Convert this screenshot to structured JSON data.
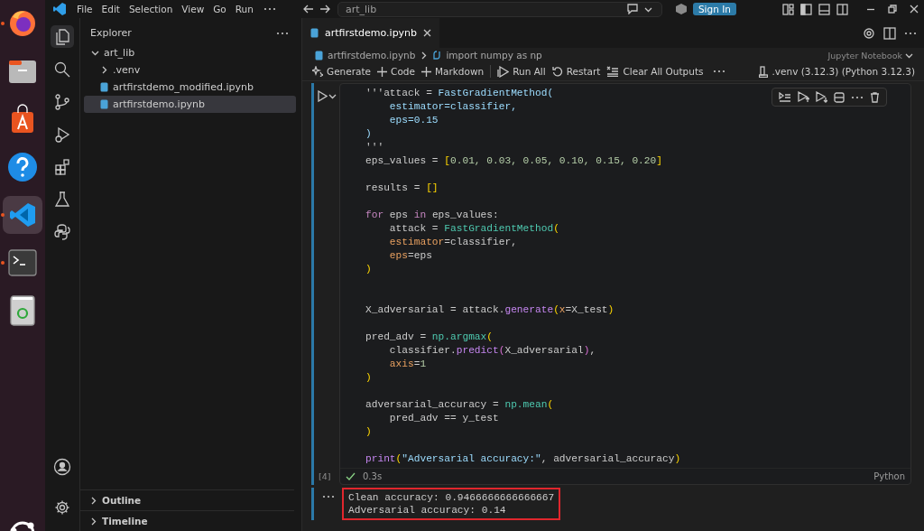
{
  "dock": {
    "items": [
      {
        "kind": "browser",
        "running": true,
        "selected": false
      },
      {
        "kind": "files",
        "running": false,
        "selected": false
      },
      {
        "kind": "store",
        "running": false,
        "selected": false
      },
      {
        "kind": "help",
        "running": false,
        "selected": false
      },
      {
        "kind": "editor",
        "running": true,
        "selected": true
      },
      {
        "kind": "terminal",
        "running": true,
        "selected": false
      },
      {
        "kind": "trash",
        "running": false,
        "selected": false
      }
    ]
  },
  "title_bar": {
    "menu": [
      "File",
      "Edit",
      "Selection",
      "View",
      "Go",
      "Run"
    ],
    "command_center": "art_lib",
    "sign_in": "Sign In"
  },
  "activity_bar": {
    "items": [
      {
        "kind": "explorer",
        "selected": true
      },
      {
        "kind": "search",
        "selected": false
      },
      {
        "kind": "source-control",
        "selected": false
      },
      {
        "kind": "run",
        "selected": false
      },
      {
        "kind": "extensions",
        "selected": false
      },
      {
        "kind": "testing",
        "selected": false
      },
      {
        "kind": "python",
        "selected": false
      }
    ]
  },
  "explorer": {
    "title": "Explorer",
    "tree": [
      {
        "label": "art_lib",
        "kind": "folder",
        "expanded": true,
        "selected": false,
        "children": [
          {
            "label": ".venv",
            "kind": "folder",
            "expanded": false,
            "selected": false
          },
          {
            "label": "artfirstdemo_modified.ipynb",
            "kind": "notebook",
            "selected": false
          },
          {
            "label": "artfirstdemo.ipynb",
            "kind": "notebook",
            "selected": true
          }
        ]
      }
    ],
    "sections": [
      {
        "label": "Outline",
        "expanded": false
      },
      {
        "label": "Timeline",
        "expanded": false
      }
    ]
  },
  "tabs": [
    {
      "label": "artfirstdemo.ipynb",
      "selected": true
    }
  ],
  "breadcrumb": [
    "artfirstdemo.ipynb",
    "import numpy as np"
  ],
  "notebook_type": "Jupyter Notebook",
  "toolbar": [
    {
      "label": "Generate",
      "kind": "sparkle"
    },
    {
      "label": "Code",
      "kind": "plus"
    },
    {
      "label": "Markdown",
      "kind": "plus"
    },
    {
      "label": "Run All",
      "kind": "run-all"
    },
    {
      "label": "Restart",
      "kind": "restart"
    },
    {
      "label": "Clear All Outputs",
      "kind": "clear"
    }
  ],
  "kernel": ".venv (3.12.3) (Python 3.12.3)",
  "cell": {
    "lines": [
      {
        "kind": "code",
        "tokens": [
          {
            "text": "'''attack = ",
            "kind": "plain"
          },
          {
            "text": "FastGradientMethod(",
            "kind": "variable"
          }
        ]
      },
      {
        "kind": "code",
        "tokens": [
          {
            "text": "    estimator=classifier,",
            "kind": "variable"
          }
        ]
      },
      {
        "kind": "code",
        "tokens": [
          {
            "text": "    eps=0.15",
            "kind": "variable"
          }
        ]
      },
      {
        "kind": "code",
        "tokens": [
          {
            "text": ")",
            "kind": "variable"
          }
        ]
      },
      {
        "kind": "code",
        "tokens": [
          {
            "text": "'''",
            "kind": "plain"
          }
        ]
      },
      {
        "kind": "code",
        "tokens": [
          {
            "text": "eps_values = ",
            "kind": "plain"
          },
          {
            "text": "[",
            "kind": "bracket"
          },
          {
            "text": "0.01, 0.03, 0.05, 0.10, 0.15, 0.20",
            "kind": "number"
          },
          {
            "text": "]",
            "kind": "bracket"
          }
        ]
      },
      {
        "kind": "blank"
      },
      {
        "kind": "code",
        "tokens": [
          {
            "text": "results = ",
            "kind": "plain"
          },
          {
            "text": "[]",
            "kind": "bracket"
          }
        ]
      },
      {
        "kind": "blank"
      },
      {
        "kind": "code",
        "tokens": [
          {
            "text": "for",
            "kind": "keyword"
          },
          {
            "text": " eps ",
            "kind": "plain"
          },
          {
            "text": "in",
            "kind": "keyword"
          },
          {
            "text": " eps_values:",
            "kind": "plain"
          }
        ]
      },
      {
        "kind": "code",
        "tokens": [
          {
            "text": "    attack = ",
            "kind": "plain"
          },
          {
            "text": "FastGradientMethod",
            "kind": "class"
          },
          {
            "text": "(",
            "kind": "bracket"
          }
        ]
      },
      {
        "kind": "code",
        "tokens": [
          {
            "text": "    estimator",
            "kind": "param"
          },
          {
            "text": "=classifier,",
            "kind": "plain"
          }
        ]
      },
      {
        "kind": "code",
        "tokens": [
          {
            "text": "    eps",
            "kind": "param"
          },
          {
            "text": "=eps",
            "kind": "plain"
          }
        ]
      },
      {
        "kind": "code",
        "tokens": [
          {
            "text": ")",
            "kind": "bracket"
          }
        ]
      },
      {
        "kind": "blank"
      },
      {
        "kind": "blank"
      },
      {
        "kind": "code",
        "tokens": [
          {
            "text": "X_adversarial = attack.",
            "kind": "plain"
          },
          {
            "text": "generate",
            "kind": "method"
          },
          {
            "text": "(",
            "kind": "bracket"
          },
          {
            "text": "x",
            "kind": "param"
          },
          {
            "text": "=X_test",
            "kind": "plain"
          },
          {
            "text": ")",
            "kind": "bracket"
          }
        ]
      },
      {
        "kind": "blank"
      },
      {
        "kind": "code",
        "tokens": [
          {
            "text": "pred_adv = ",
            "kind": "plain"
          },
          {
            "text": "np.argmax",
            "kind": "class"
          },
          {
            "text": "(",
            "kind": "bracket"
          }
        ]
      },
      {
        "kind": "code",
        "tokens": [
          {
            "text": "    classifier.",
            "kind": "plain"
          },
          {
            "text": "predict",
            "kind": "method"
          },
          {
            "text": "(",
            "kind": "bracket2"
          },
          {
            "text": "X_adversarial",
            "kind": "plain"
          },
          {
            "text": ")",
            "kind": "bracket2"
          },
          {
            "text": ",",
            "kind": "plain"
          }
        ]
      },
      {
        "kind": "code",
        "tokens": [
          {
            "text": "    axis",
            "kind": "param"
          },
          {
            "text": "=",
            "kind": "plain"
          },
          {
            "text": "1",
            "kind": "number"
          }
        ]
      },
      {
        "kind": "code",
        "tokens": [
          {
            "text": ")",
            "kind": "bracket"
          }
        ]
      },
      {
        "kind": "blank"
      },
      {
        "kind": "code",
        "tokens": [
          {
            "text": "adversarial_accuracy = ",
            "kind": "plain"
          },
          {
            "text": "np.mean",
            "kind": "class"
          },
          {
            "text": "(",
            "kind": "bracket"
          }
        ]
      },
      {
        "kind": "code",
        "tokens": [
          {
            "text": "    pred_adv == y_test",
            "kind": "plain"
          }
        ]
      },
      {
        "kind": "code",
        "tokens": [
          {
            "text": ")",
            "kind": "bracket"
          }
        ]
      },
      {
        "kind": "blank"
      },
      {
        "kind": "code",
        "tokens": [
          {
            "text": "print",
            "kind": "method"
          },
          {
            "text": "(",
            "kind": "bracket"
          },
          {
            "text": "\"Adversarial accuracy:\"",
            "kind": "string"
          },
          {
            "text": ", adversarial_accuracy",
            "kind": "plain"
          },
          {
            "text": ")",
            "kind": "bracket"
          }
        ]
      }
    ],
    "execution_count": "[4]",
    "succeeded": true,
    "duration": "0.3s",
    "language": "Python"
  },
  "output": {
    "lines": [
      "Clean accuracy: 0.9466666666666667",
      "Adversarial accuracy: 0.14"
    ],
    "highlighted": true
  }
}
